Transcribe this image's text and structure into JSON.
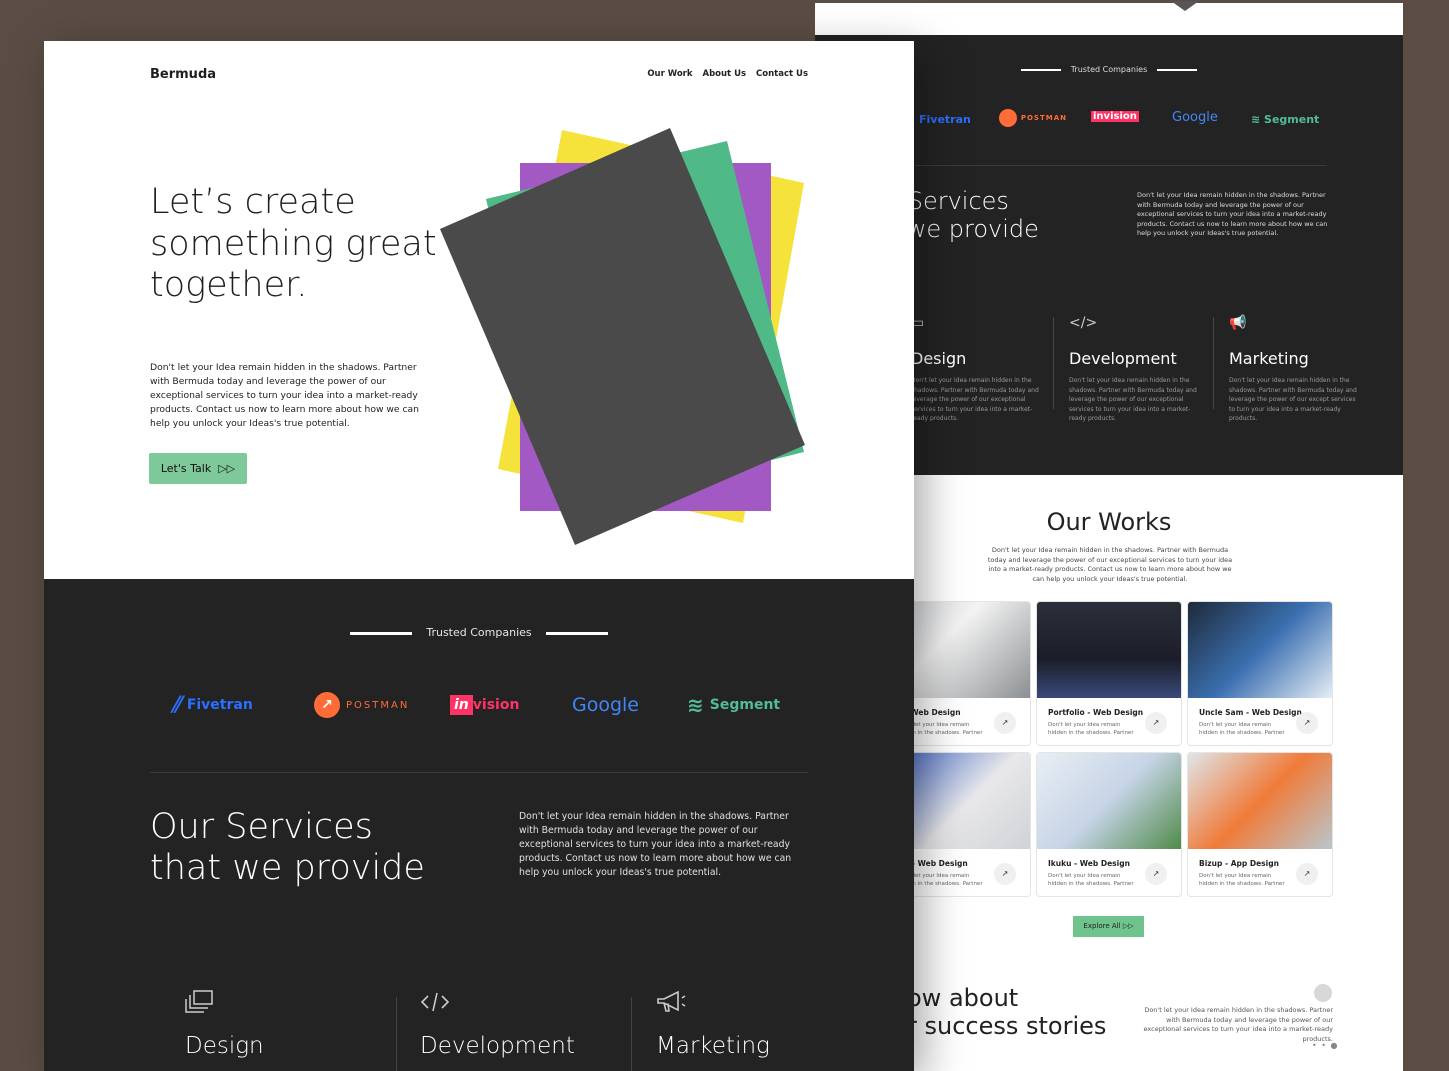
{
  "back_screen": {
    "trusted_label": "Trusted Companies",
    "logos": [
      {
        "name": "Fivetran",
        "color": "#2a6fff"
      },
      {
        "name": "POSTMAN",
        "color": "#ff6c37"
      },
      {
        "name": "invision",
        "color": "#ff3366"
      },
      {
        "name": "Google",
        "color": "#4285f4"
      },
      {
        "name": "Segment",
        "color": "#52bd94"
      }
    ],
    "services_title_line1": "ur Services",
    "services_title_line2": "at we provide",
    "services_desc": "Don't let your Idea remain hidden in the shadows. Partner with Bermuda today and leverage the power of our exceptional services to turn your idea into a market-ready products. Contact us now to learn more about how we can help you unlock your Ideas's true potential.",
    "services": [
      {
        "title": "Design",
        "icon": "layers-icon",
        "desc": "Don't let your Idea remain hidden in the shadows. Partner with Bermuda today and leverage the power of our exceptional services to turn your idea into a market-ready products."
      },
      {
        "title": "Development",
        "icon": "code-icon",
        "desc": "Don't let your Idea remain hidden in the shadows. Partner with Bermuda today and leverage the power of our exceptional services to turn your idea into a market-ready products."
      },
      {
        "title": "Marketing",
        "icon": "megaphone-icon",
        "desc": "Don't let your Idea remain hidden in the shadows. Partner with Bermuda today and leverage the power of our except services to turn your idea into a market-ready products."
      }
    ],
    "works_title": "Our Works",
    "works_desc": "Don't let your Idea remain hidden in the shadows. Partner with Bermuda today and leverage the power of our exceptional services to turn your idea into a market-ready products. Contact us now to learn more about how we can help you unlock your Ideas's true potential.",
    "works": [
      {
        "title": "e - Web Design",
        "desc": "Don't let your Idea remain hidden in the shadows. Partner"
      },
      {
        "title": "Portfolio - Web Design",
        "desc": "Don't let your Idea remain hidden in the shadows. Partner"
      },
      {
        "title": "Uncle Sam - Web Design",
        "desc": "Don't let your Idea remain hidden in the shadows. Partner"
      },
      {
        "title": "ms - Web Design",
        "desc": "Don't let your Idea remain hidden in the shadows. Partner"
      },
      {
        "title": "Ikuku - Web Design",
        "desc": "Don't let your Idea remain hidden in the shadows. Partner"
      },
      {
        "title": "Bizup - App Design",
        "desc": "Don't let your Idea remain hidden in the shadows. Partner"
      }
    ],
    "explore_label": "Explore All",
    "success_line1": "ow about",
    "success_line2": "r success stories",
    "success_desc": "Don't let your Idea remain hidden in the shadows. Partner with Bermuda today and leverage the power of our exceptional services to turn your idea into a market-ready products."
  },
  "front_screen": {
    "brand": "Bermuda",
    "nav": [
      "Our Work",
      "About Us",
      "Contact Us"
    ],
    "headline": "Let’s create something great together.",
    "lead": "Don't let your Idea remain hidden in the shadows. Partner with Bermuda today and leverage the power of our exceptional services to turn your idea into a market-ready products. Contact us now to learn more about how we can help you unlock your Ideas's true potential.",
    "cta_label": "Let's Talk",
    "trusted_label": "Trusted Companies",
    "logos": [
      {
        "name": "Fivetran",
        "color": "#2a6fff"
      },
      {
        "name": "POSTMAN",
        "color": "#ff6c37"
      },
      {
        "name": "vision",
        "prefix": "in",
        "color": "#ff3366"
      },
      {
        "name": "Google",
        "color": "#4285f4"
      },
      {
        "name": "Segment",
        "color": "#52bd94"
      }
    ],
    "services_title_line1": "Our Services",
    "services_title_line2": "that we provide",
    "services_desc": "Don't let your Idea remain hidden in the shadows. Partner with Bermuda today and leverage the power of our exceptional services to turn your idea into a market-ready products. Contact us now to learn more about how we can help you unlock your Ideas's true potential.",
    "services": [
      {
        "title": "Design",
        "icon": "layers-icon"
      },
      {
        "title": "Development",
        "icon": "code-icon"
      },
      {
        "title": "Marketing",
        "icon": "megaphone-icon"
      }
    ]
  },
  "colors": {
    "background": "#5b4d45",
    "dark": "#232323",
    "accent_green": "#7ec99a",
    "paper_yellow": "#f5e33b",
    "paper_purple": "#a259c4",
    "paper_green": "#4fba87",
    "paper_gray": "#4a4a4a"
  }
}
